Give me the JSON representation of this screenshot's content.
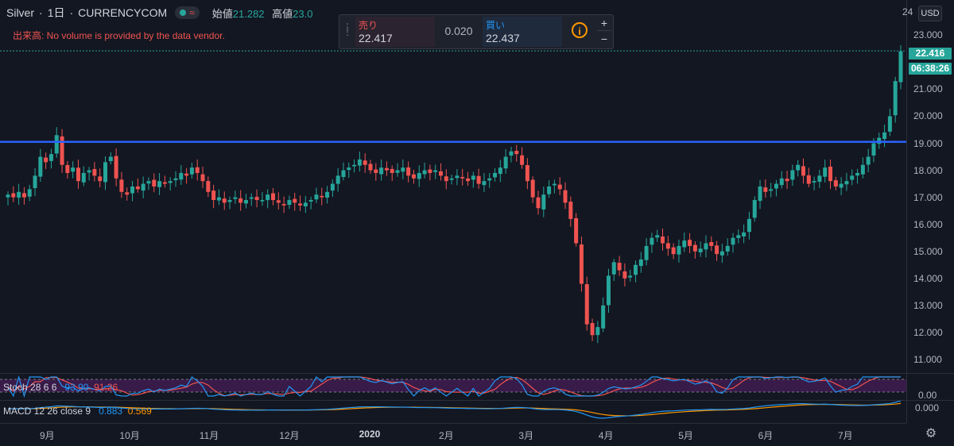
{
  "header": {
    "symbol": "Silver",
    "interval": "1日",
    "source": "CURRENCYCOM",
    "approx_icon": "≈",
    "open_label": "始値",
    "open_value": "21.282",
    "high_label": "高値",
    "high_value": "23.0"
  },
  "volume_message": "出来高: No volume is provided by the data vendor.",
  "trade_panel": {
    "sell_label": "売り",
    "sell_price": "22.417",
    "spread": "0.020",
    "buy_label": "買い",
    "buy_price": "22.437",
    "info_icon": "i",
    "plus": "+",
    "minus": "−"
  },
  "price_axis": {
    "currency": "USD",
    "ticks": [
      "23.000",
      "21.000",
      "20.000",
      "19.000",
      "18.000",
      "17.000",
      "16.000",
      "15.000",
      "14.000",
      "13.000",
      "12.000",
      "11.000"
    ],
    "top_partial": "24",
    "last_price": "22.416",
    "countdown": "06:38:26",
    "stoch_tick": "0.00",
    "macd_tick": "0.000"
  },
  "time_axis": [
    "9月",
    "10月",
    "11月",
    "12月",
    "2020",
    "2月",
    "3月",
    "4月",
    "5月",
    "6月",
    "7月"
  ],
  "stoch": {
    "name": "Stoch 28 6 6",
    "k": "93.90",
    "d": "91.26"
  },
  "macd": {
    "name": "MACD 12 26 close 9",
    "macd": "0.883",
    "signal": "0.569"
  },
  "colors": {
    "up": "#26a69a",
    "down": "#ef5350",
    "hline": "#2962ff",
    "stoch_k": "#2196f3",
    "stoch_d": "#ef5350",
    "macd": "#2196f3",
    "signal": "#ff9800",
    "band": "#9c27b0"
  },
  "chart_data": {
    "type": "candlestick",
    "y_range": [
      10.5,
      24.3
    ],
    "x_range": [
      0,
      159
    ],
    "horizontal_line": 19.05,
    "last_price": 22.416,
    "closes": [
      17.1,
      17.0,
      17.2,
      17.0,
      17.3,
      17.8,
      18.5,
      18.3,
      18.6,
      19.3,
      18.2,
      17.9,
      18.1,
      17.6,
      17.9,
      18.0,
      17.8,
      17.6,
      18.3,
      18.5,
      17.7,
      17.2,
      17.1,
      17.4,
      17.3,
      17.5,
      17.6,
      17.4,
      17.6,
      17.5,
      17.6,
      17.7,
      17.9,
      17.8,
      18.1,
      17.9,
      17.6,
      17.2,
      16.9,
      17.0,
      16.8,
      16.9,
      17.0,
      16.8,
      16.9,
      17.0,
      16.9,
      16.9,
      17.1,
      16.9,
      16.8,
      16.7,
      16.9,
      16.8,
      16.7,
      16.8,
      16.9,
      17.1,
      17.0,
      17.2,
      17.5,
      17.8,
      18.0,
      18.1,
      18.2,
      18.4,
      18.2,
      18.0,
      17.9,
      18.1,
      18.0,
      17.9,
      18.0,
      18.1,
      17.8,
      17.7,
      17.9,
      18.0,
      17.9,
      18.0,
      17.8,
      17.6,
      17.7,
      17.8,
      17.7,
      17.6,
      17.8,
      17.5,
      17.6,
      17.7,
      17.9,
      18.1,
      18.5,
      18.7,
      18.6,
      18.2,
      17.6,
      17.0,
      16.6,
      17.1,
      17.4,
      17.5,
      17.3,
      16.8,
      16.2,
      15.3,
      13.8,
      12.3,
      11.9,
      12.2,
      13.0,
      14.1,
      14.6,
      14.3,
      14.0,
      14.1,
      14.5,
      14.7,
      15.2,
      15.5,
      15.6,
      15.3,
      15.1,
      14.9,
      15.2,
      15.4,
      15.2,
      15.0,
      15.1,
      15.3,
      15.2,
      14.9,
      15.0,
      15.2,
      15.5,
      15.6,
      15.7,
      16.2,
      16.9,
      17.4,
      17.2,
      17.3,
      17.5,
      17.7,
      17.6,
      18.0,
      18.2,
      17.8,
      17.5,
      17.6,
      17.8,
      18.1,
      17.6,
      17.4,
      17.5,
      17.6,
      17.8,
      17.9,
      18.2,
      18.5,
      19.0,
      19.2,
      19.4,
      20.0,
      21.3,
      22.4
    ]
  }
}
